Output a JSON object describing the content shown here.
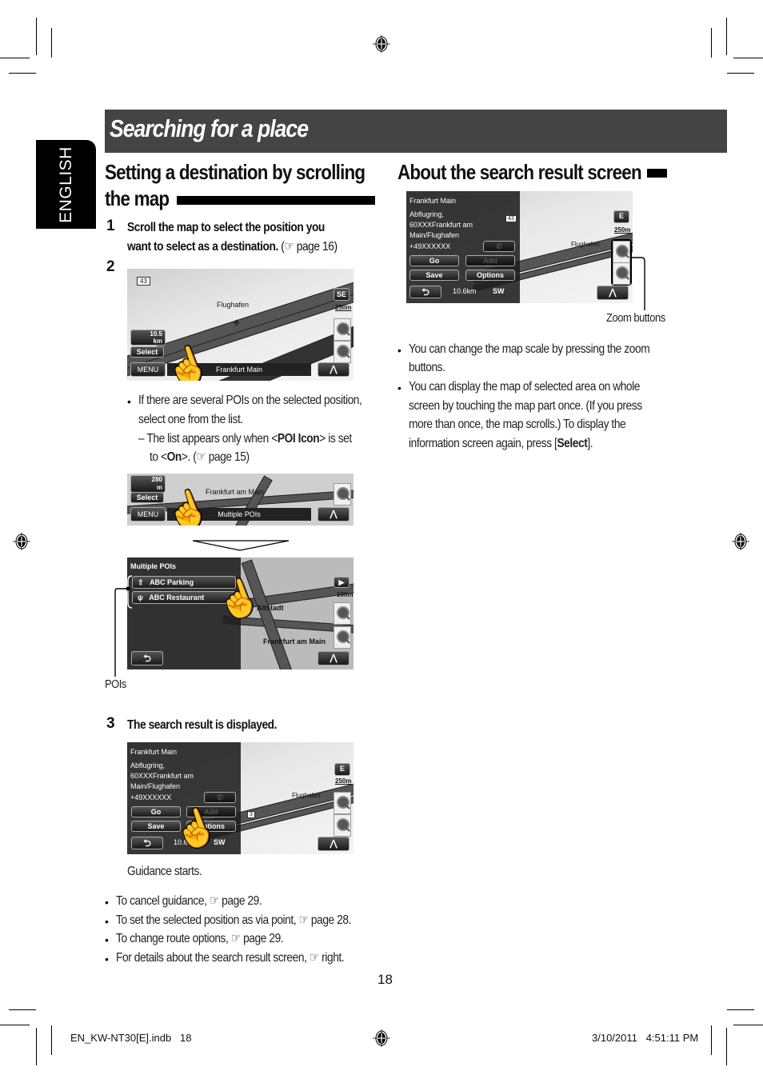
{
  "page": {
    "section_title": "Searching for a place",
    "language_tab": "ENGLISH",
    "page_number": "18"
  },
  "left": {
    "heading_line1": "Setting a destination by scrolling",
    "heading_line2": "the map",
    "step1": {
      "num": "1",
      "line1": "Scroll the map to select the position you",
      "line2_bold": "want to select as a destination.",
      "line2_ref": " (☞ page 16)"
    },
    "step2": {
      "num": "2",
      "bullet": {
        "line1": "If there are several POIs on the selected position,",
        "line2": "select one from the list.",
        "sub_a": "– The list appears only when <",
        "sub_b": "POI Icon",
        "sub_c": "> is set",
        "sub2_a": "to <",
        "sub2_b": "On",
        "sub2_c": ">. (☞ page 15)"
      }
    },
    "screen1": {
      "road_badge": "43",
      "place_label": "Flughafen",
      "compass": "SE",
      "scale": "250m",
      "distance": "10.5",
      "distance_unit": "km",
      "select_btn": "Select",
      "menu_btn": "MENU",
      "location": "Frankfurt Main"
    },
    "screen2": {
      "distance": "280",
      "distance_unit": "m",
      "select_btn": "Select",
      "menu_btn": "MENU",
      "place_label": "Frankfurt am Main",
      "status": "Multiple POIs"
    },
    "screen3": {
      "header": "Multiple POIs",
      "items": [
        {
          "icon": "parking-icon",
          "label": "ABC Parking"
        },
        {
          "icon": "restaurant-icon",
          "label": "ABC Restaurant"
        }
      ],
      "map_labels": [
        "Altstadt",
        "Frankfurt am Main"
      ],
      "scale": "100m",
      "callout": "POIs"
    },
    "step3": {
      "num": "3",
      "text": "The search result is displayed."
    },
    "screen4": {
      "name": "Frankfurt Main",
      "address1": "Abflugring,",
      "address2": "60XXXFrankfurt am",
      "address3": "Main/Flughafen",
      "phone": "+49XXXXXX",
      "go_btn": "Go",
      "add_btn": "Add",
      "save_btn": "Save",
      "options_btn": "Options",
      "distance": "10.6km",
      "direction": "SW",
      "compass": "E",
      "scale": "250m",
      "road_badge": "43",
      "place_label": "Flughafen"
    },
    "guidance_text": "Guidance starts.",
    "notes": [
      "To cancel guidance, ☞ page 29.",
      "To set the selected position as via point, ☞ page 28.",
      "To change route options, ☞ page 29.",
      "For details about the search result screen, ☞ right."
    ]
  },
  "right": {
    "heading": "About the search result screen",
    "screen": {
      "name": "Frankfurt Main",
      "address1": "Abflugring,",
      "address2": "60XXXFrankfurt am",
      "address3": "Main/Flughafen",
      "phone": "+49XXXXXX",
      "go_btn": "Go",
      "add_btn": "Add",
      "save_btn": "Save",
      "options_btn": "Options",
      "distance": "10.6km",
      "direction": "SW",
      "compass": "E",
      "scale": "250m",
      "road_badge": "43",
      "place_label": "Flughafen"
    },
    "callout": "Zoom buttons",
    "bullets": [
      {
        "lines": [
          "You can change the map scale by pressing the zoom",
          "buttons."
        ]
      },
      {
        "lines": [
          "You can display the map of selected area on whole",
          "screen by touching the map part once. (If you press",
          "more than once, the map scrolls.) To display the"
        ],
        "last_a": "information screen again, press [",
        "last_b": "Select",
        "last_c": "]."
      }
    ]
  },
  "footer": {
    "file": "EN_KW-NT30[E].indb   18",
    "timestamp": "3/10/2011   4:51:11 PM"
  }
}
